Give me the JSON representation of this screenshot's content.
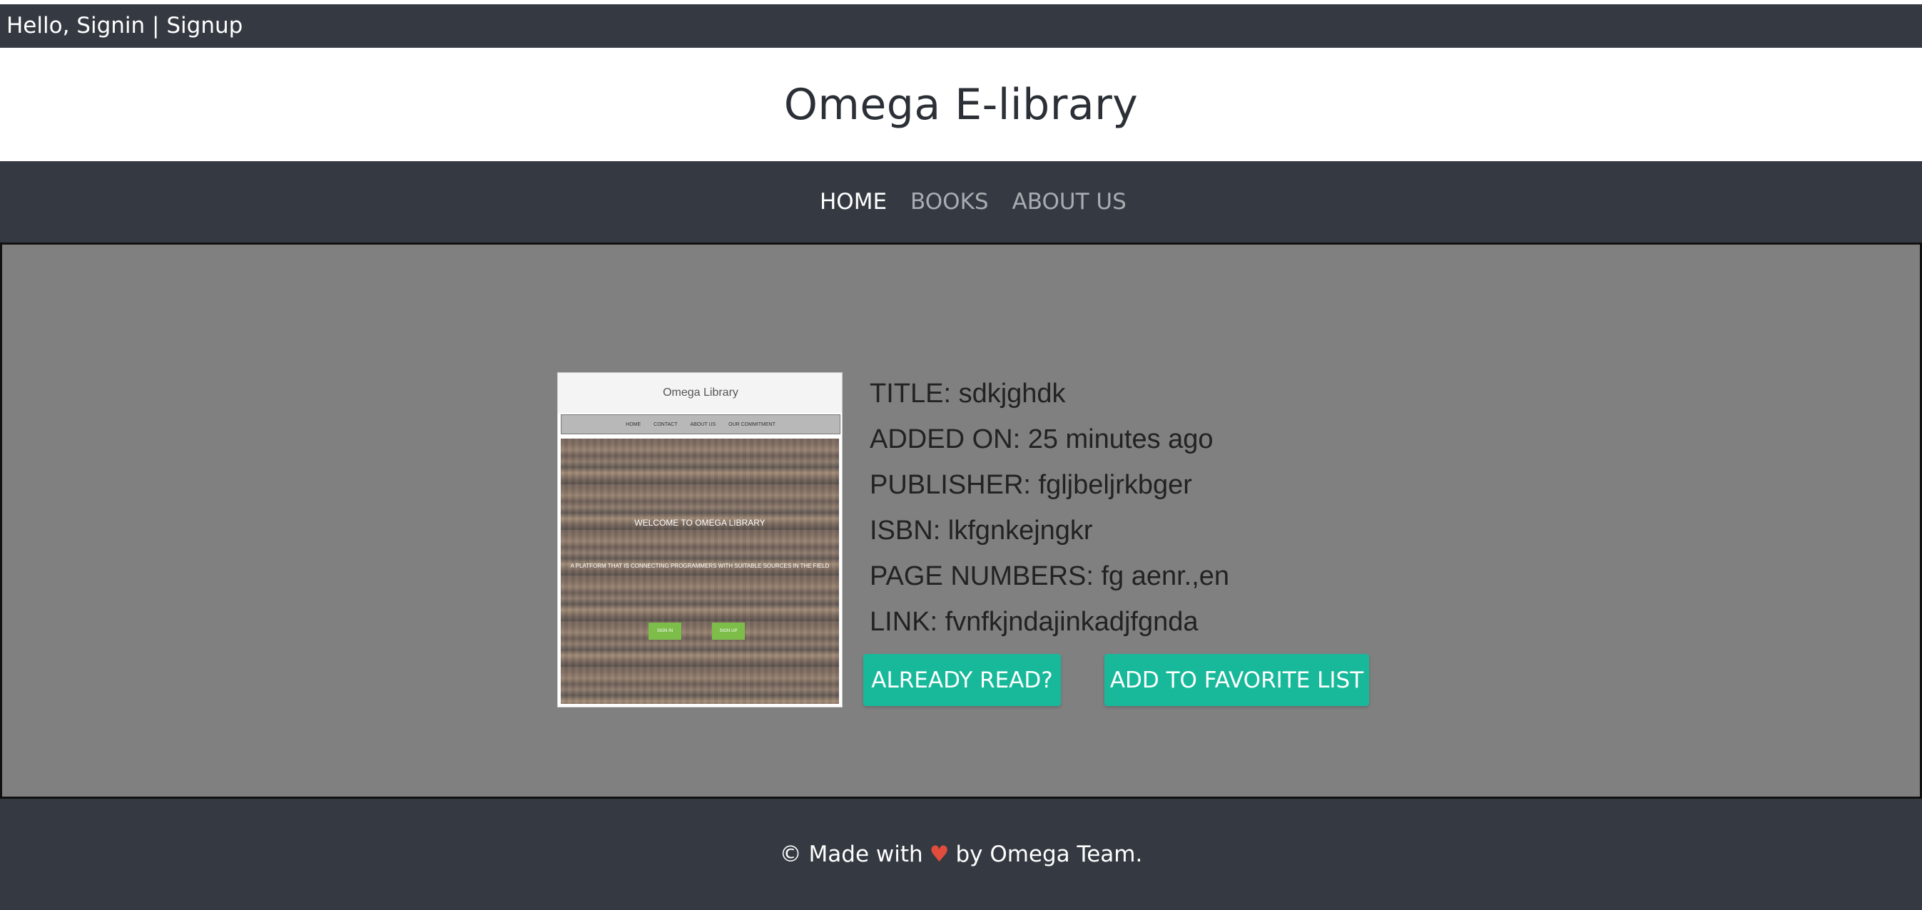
{
  "topbar": {
    "greeting": "Hello,",
    "signin": "Signin",
    "separator": "|",
    "signup": "Signup"
  },
  "brand": {
    "title": "Omega E-library"
  },
  "nav": {
    "items": [
      {
        "label": "HOME",
        "active": true
      },
      {
        "label": "BOOKS",
        "active": false
      },
      {
        "label": "ABOUT US",
        "active": false
      }
    ]
  },
  "book": {
    "cover": {
      "header_title": "Omega Library",
      "nav_items": [
        "HOME",
        "CONTACT",
        "ABOUT US",
        "OUR COMMITMENT"
      ],
      "headline": "WELCOME TO OMEGA LIBRARY",
      "subheadline": "A PLATFORM THAT IS CONNECTING PROGRAMMERS WITH SUITABLE SOURCES IN THE FIELD",
      "buttons": [
        "SIGN IN",
        "SIGN UP"
      ]
    },
    "title": "TITLE: sdkjghdk",
    "added_on": "ADDED ON: 25 minutes ago",
    "publisher": "PUBLISHER: fgljbeljrkbger",
    "isbn": "ISBN: lkfgnkejngkr",
    "page_numbers": "PAGE NUMBERS: fg aenr.,en",
    "link": "LINK: fvnfkjndajinkadjfgnda"
  },
  "actions": {
    "already_read": "ALREADY READ?",
    "favorite": "ADD TO FAVORITE LIST"
  },
  "footer": {
    "prefix": "© Made with",
    "heart": "♥",
    "suffix": "by Omega Team."
  },
  "colors": {
    "topbar_bg": "#353a42",
    "content_bg": "#808080",
    "accent": "#18b99a",
    "heart": "#e24c3c"
  }
}
